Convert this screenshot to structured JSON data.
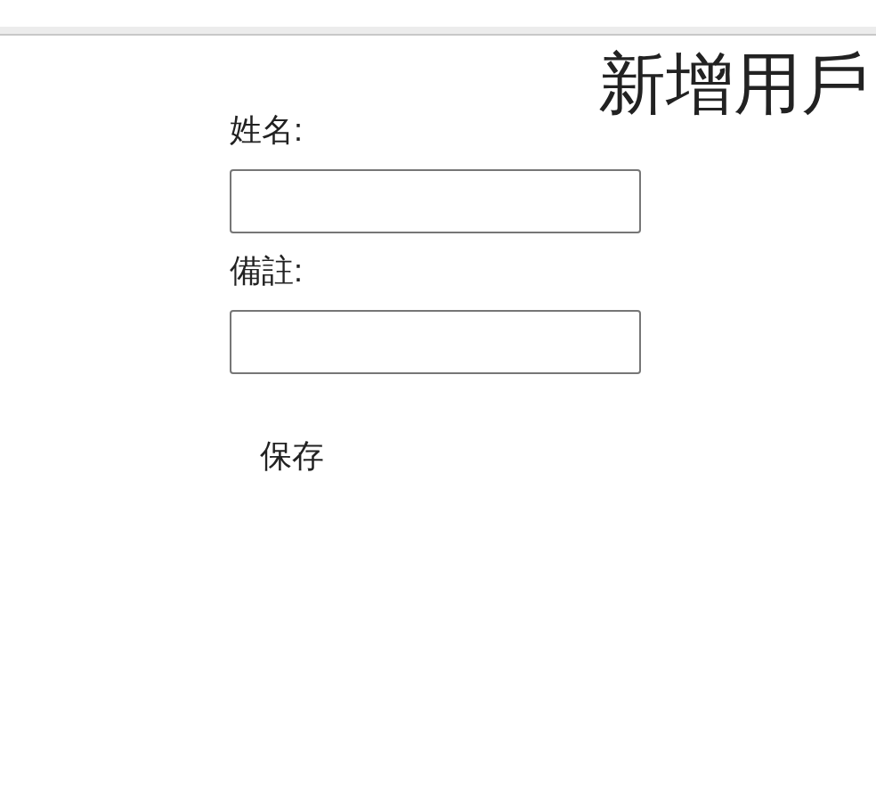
{
  "title": "新增用戶",
  "fields": [
    {
      "label": "姓名:"
    },
    {
      "label": "備註:"
    }
  ],
  "submit_button": "保存"
}
